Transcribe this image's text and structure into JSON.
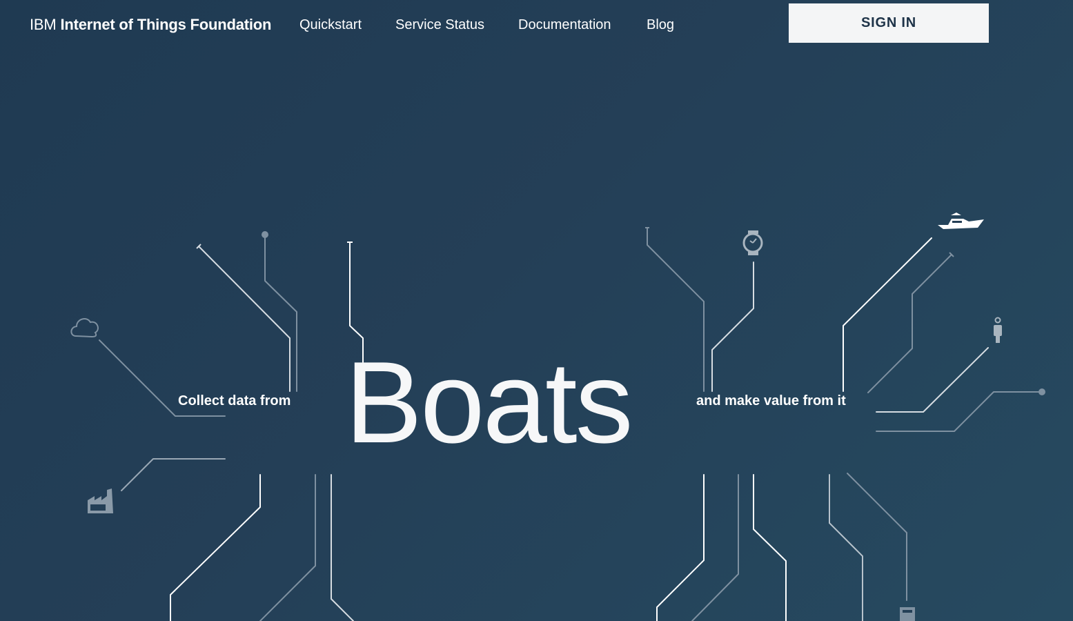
{
  "header": {
    "brand_prefix": "IBM",
    "brand_name": "Internet of Things Foundation",
    "nav": [
      {
        "label": "Quickstart"
      },
      {
        "label": "Service Status"
      },
      {
        "label": "Documentation"
      },
      {
        "label": "Blog"
      }
    ],
    "sign_in_label": "SIGN IN"
  },
  "hero": {
    "lead_text": "Collect data from",
    "highlight_word": "Boats",
    "trail_text": "and make value from it"
  },
  "icons": [
    "cloud-icon",
    "factory-icon",
    "watch-icon",
    "boat-icon",
    "person-icon",
    "device-icon"
  ],
  "colors": {
    "background": "#233f56",
    "accent_line": "#ffffff",
    "muted_line": "#8a9aa8",
    "button_bg": "#f4f5f6",
    "button_text": "#1e3348"
  }
}
